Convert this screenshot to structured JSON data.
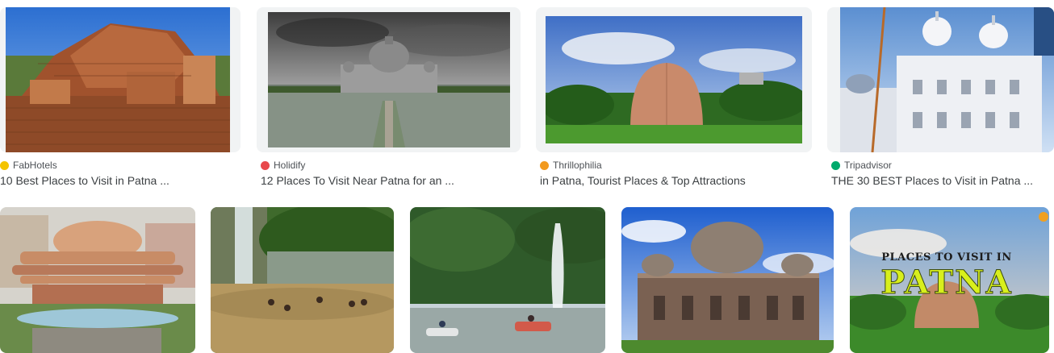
{
  "results_row1": [
    {
      "source": "FabHotels",
      "title": "10 Best Places to Visit in Patna ...",
      "fav_color": "#f4c400",
      "image": "Nalanda ruins"
    },
    {
      "source": "Holidify",
      "title": "12 Places To Visit Near Patna for an ...",
      "fav_color": "#e8484b",
      "image": "Sher Shah Suri tomb"
    },
    {
      "source": "Thrillophilia",
      "title": "in Patna, Tourist Places & Top Attractions",
      "fav_color": "#f29a1f",
      "image": "Golghar"
    },
    {
      "source": "Tripadvisor",
      "title": "THE 30 BEST Places to Visit in Patna ...",
      "fav_color": "#00aa6c",
      "image": "Takht Sri Patna Sahib"
    }
  ],
  "results_row2": [
    {
      "image": "Patna planetarium"
    },
    {
      "image": "Waterfall pool"
    },
    {
      "image": "Fountain lake boats"
    },
    {
      "image": "Tomb monument"
    },
    {
      "image": "Places to visit in Patna banner",
      "overlay_line1": "PLACES TO VISIT IN",
      "overlay_line2": "PATNA"
    }
  ],
  "colors": {
    "text_title": "#3c4043",
    "text_source": "#4d5156",
    "card_bg": "#f1f3f4"
  }
}
